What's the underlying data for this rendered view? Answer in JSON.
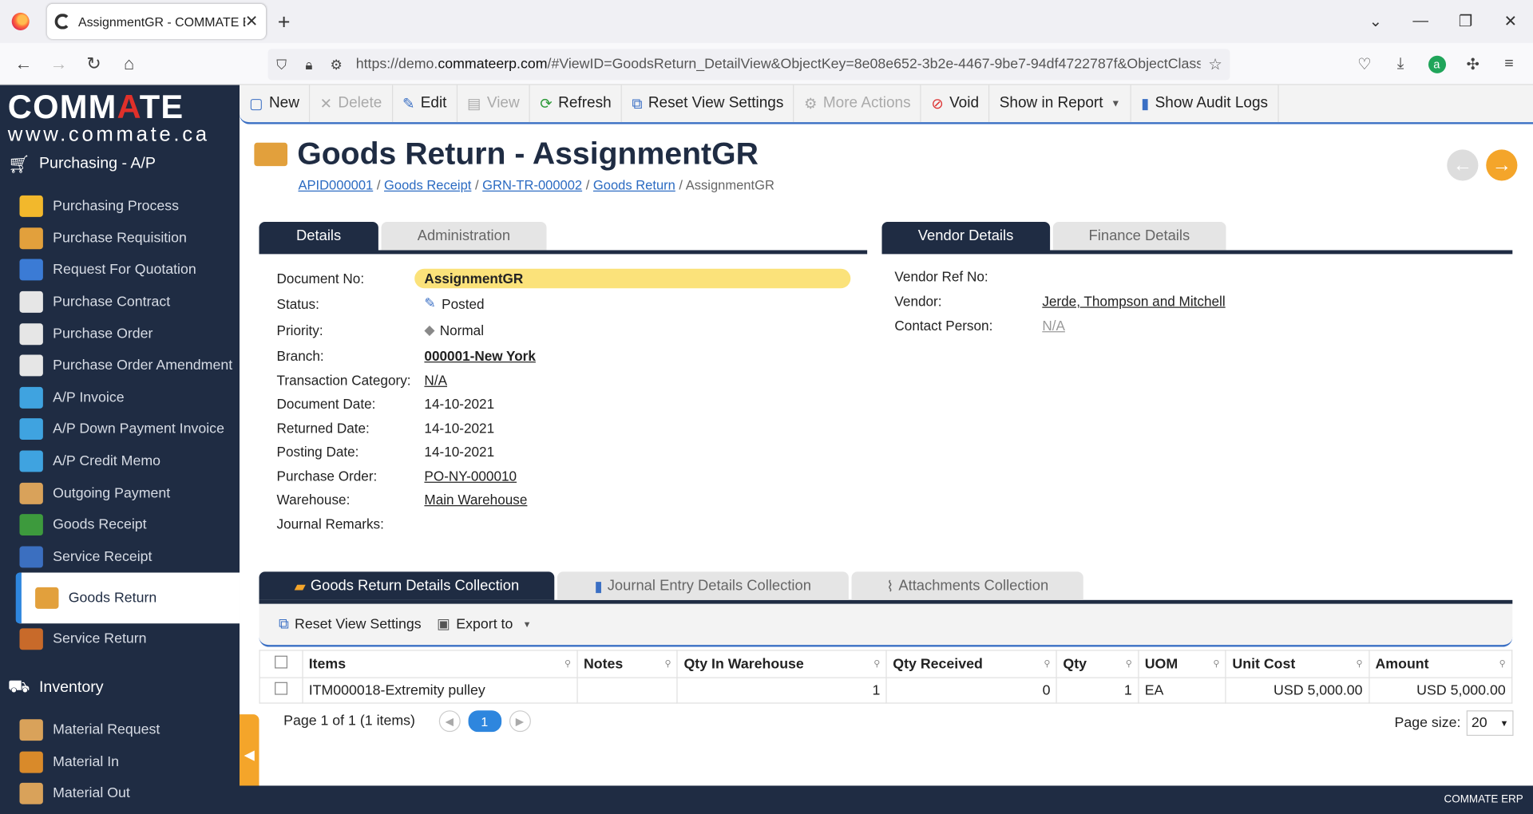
{
  "browser": {
    "tab_title": "AssignmentGR - COMMATE ERP",
    "url_prefix": "https://demo.",
    "url_domain": "commateerp.com",
    "url_rest": "/#ViewID=GoodsReturn_DetailView&ObjectKey=8e08e652-3b2e-4467-9be7-94df4722787f&ObjectClassNa"
  },
  "logo": {
    "line1_a": "COMM",
    "line1_b": "A",
    "line1_c": "TE",
    "line2": "www.commate.ca"
  },
  "sidebar": {
    "section1": "Purchasing - A/P",
    "items": [
      {
        "label": "Purchasing Process",
        "color": "#f2b82c"
      },
      {
        "label": "Purchase Requisition",
        "color": "#e2a03c"
      },
      {
        "label": "Request For Quotation",
        "color": "#3b7bd5"
      },
      {
        "label": "Purchase Contract",
        "color": "#e6e6e6"
      },
      {
        "label": "Purchase Order",
        "color": "#e6e6e6"
      },
      {
        "label": "Purchase Order Amendment",
        "color": "#e6e6e6"
      },
      {
        "label": "A/P Invoice",
        "color": "#3fa3e0"
      },
      {
        "label": "A/P Down Payment Invoice",
        "color": "#3fa3e0"
      },
      {
        "label": "A/P Credit Memo",
        "color": "#3fa3e0"
      },
      {
        "label": "Outgoing Payment",
        "color": "#d9a25a"
      },
      {
        "label": "Goods Receipt",
        "color": "#3d9a3d"
      },
      {
        "label": "Service Receipt",
        "color": "#3b6fc0"
      }
    ],
    "active": "Goods Return",
    "after": [
      {
        "label": "Service Return",
        "color": "#c86a2a"
      }
    ],
    "section2": "Inventory",
    "items2": [
      {
        "label": "Material Request",
        "color": "#d9a25a"
      },
      {
        "label": "Material In",
        "color": "#d98a2a"
      },
      {
        "label": "Material Out",
        "color": "#d9a25a"
      }
    ]
  },
  "toolbar": {
    "new": "New",
    "delete": "Delete",
    "edit": "Edit",
    "view": "View",
    "refresh": "Refresh",
    "reset_view": "Reset View Settings",
    "more_actions": "More Actions",
    "void": "Void",
    "show_in_report": "Show in Report",
    "show_audit_logs": "Show Audit Logs"
  },
  "page": {
    "title": "Goods Return - AssignmentGR",
    "breadcrumb": [
      "APID000001",
      "Goods Receipt",
      "GRN-TR-000002",
      "Goods Return"
    ],
    "breadcrumb_current": "AssignmentGR"
  },
  "tabs_left": [
    "Details",
    "Administration"
  ],
  "tabs_right": [
    "Vendor Details",
    "Finance Details"
  ],
  "details": {
    "document_no_label": "Document No:",
    "document_no": "AssignmentGR",
    "status_label": "Status:",
    "status": "Posted",
    "priority_label": "Priority:",
    "priority": "Normal",
    "branch_label": "Branch:",
    "branch": "000001-New York",
    "transaction_category_label": "Transaction Category:",
    "transaction_category": "N/A",
    "document_date_label": "Document Date:",
    "document_date": "14-10-2021",
    "returned_date_label": "Returned Date:",
    "returned_date": "14-10-2021",
    "posting_date_label": "Posting Date:",
    "posting_date": "14-10-2021",
    "purchase_order_label": "Purchase Order:",
    "purchase_order": "PO-NY-000010",
    "warehouse_label": "Warehouse:",
    "warehouse": "Main Warehouse",
    "journal_remarks_label": "Journal Remarks:"
  },
  "vendor": {
    "vendor_ref_label": "Vendor Ref No:",
    "vendor_label": "Vendor:",
    "vendor": "Jerde, Thompson and Mitchell",
    "contact_label": "Contact Person:",
    "contact": "N/A"
  },
  "collections_tabs": [
    "Goods Return Details Collection",
    "Journal Entry Details Collection",
    "Attachments Collection"
  ],
  "grid_toolbar": {
    "reset": "Reset View Settings",
    "export": "Export to"
  },
  "grid": {
    "columns": [
      "Items",
      "Notes",
      "Qty In Warehouse",
      "Qty Received",
      "Qty",
      "UOM",
      "Unit Cost",
      "Amount"
    ],
    "rows": [
      [
        "ITM000018-Extremity pulley",
        "",
        "1",
        "0",
        "1",
        "EA",
        "USD 5,000.00",
        "USD 5,000.00"
      ]
    ]
  },
  "pager": {
    "summary": "Page 1 of 1 (1 items)",
    "current": "1",
    "page_size_label": "Page size:",
    "page_size": "20"
  },
  "footer": {
    "text": "COMMATE ERP"
  }
}
